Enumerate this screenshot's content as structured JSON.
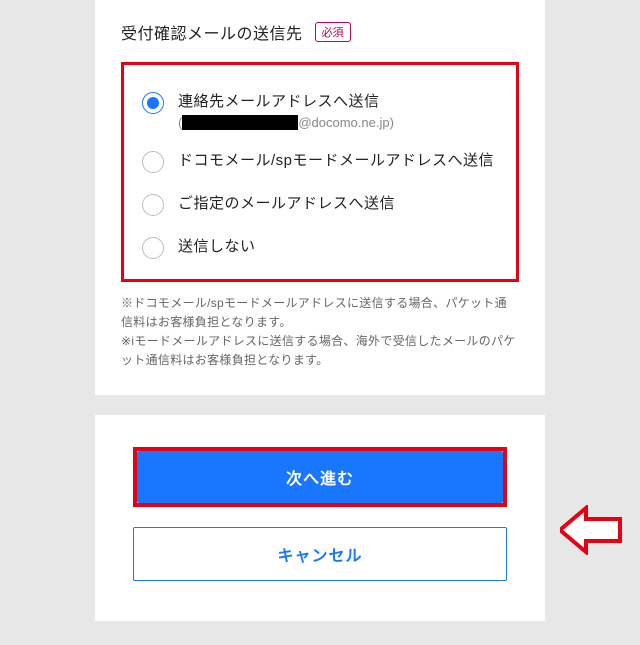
{
  "header": {
    "title": "受付確認メールの送信先",
    "badge": "必須"
  },
  "options": [
    {
      "label": "連絡先メールアドレスへ送信",
      "sublabel_domain": "@docomo.ne.jp)",
      "sublabel_prefix": "(",
      "checked": true
    },
    {
      "label": "ドコモメール/spモードメールアドレスへ送信",
      "checked": false
    },
    {
      "label": "ご指定のメールアドレスへ送信",
      "checked": false
    },
    {
      "label": "送信しない",
      "checked": false
    }
  ],
  "notes": {
    "note1": "※ドコモメール/spモードメールアドレスに送信する場合、パケット通信料はお客様負担となります。",
    "note2": "※iモードメールアドレスに送信する場合、海外で受信したメールのパケット通信料はお客様負担となります。"
  },
  "buttons": {
    "primary": "次へ進む",
    "secondary": "キャンセル"
  },
  "colors": {
    "highlight_border": "#e60012",
    "primary_blue": "#1976ff",
    "badge_magenta": "#c40058"
  }
}
